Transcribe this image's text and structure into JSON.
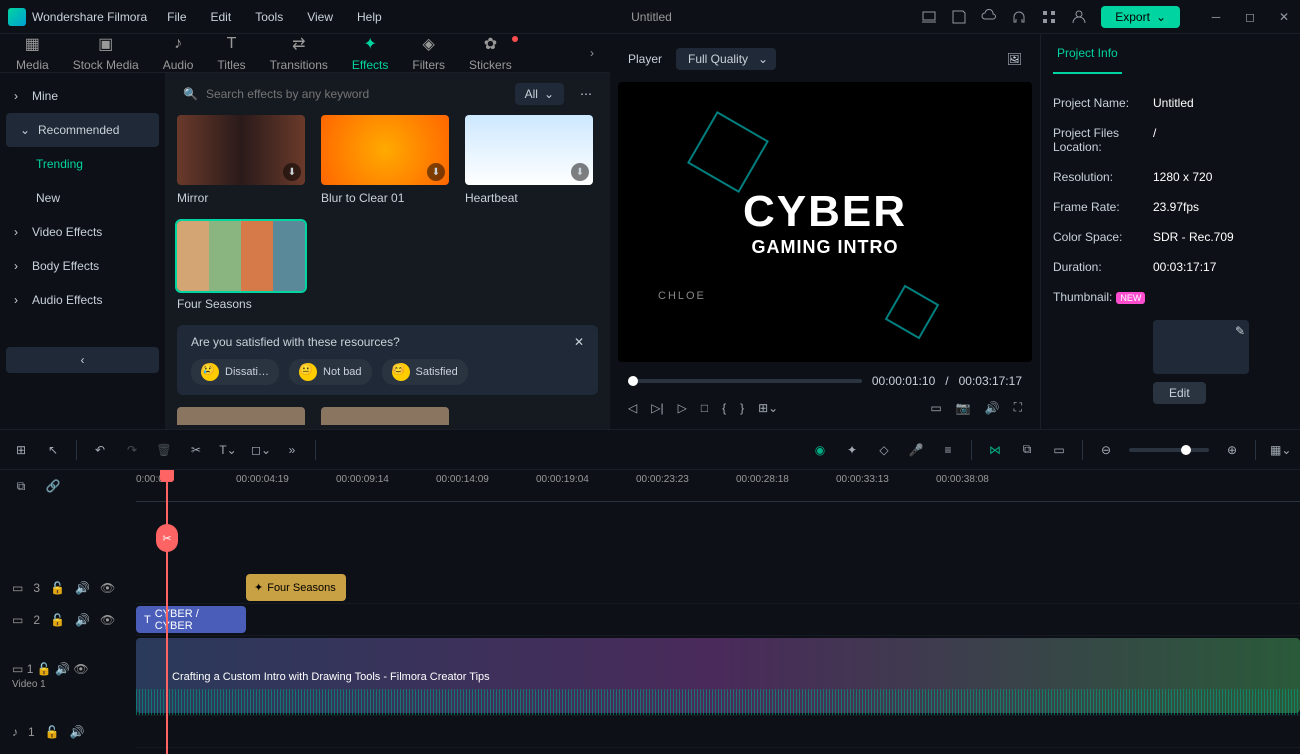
{
  "app": {
    "name": "Wondershare Filmora"
  },
  "menu": [
    "File",
    "Edit",
    "Tools",
    "View",
    "Help"
  ],
  "document": "Untitled",
  "export_label": "Export",
  "tabs": [
    {
      "label": "Media",
      "icon": "▦"
    },
    {
      "label": "Stock Media",
      "icon": "☁"
    },
    {
      "label": "Audio",
      "icon": "♪"
    },
    {
      "label": "Titles",
      "icon": "T"
    },
    {
      "label": "Transitions",
      "icon": "⇄"
    },
    {
      "label": "Effects",
      "icon": "✦",
      "active": true
    },
    {
      "label": "Filters",
      "icon": "◈"
    },
    {
      "label": "Stickers",
      "icon": "✿",
      "new": true
    }
  ],
  "sidebar": {
    "items": [
      "Mine",
      "Recommended",
      "Video Effects",
      "Body Effects",
      "Audio Effects"
    ],
    "subs": [
      "Trending",
      "New"
    ]
  },
  "search": {
    "placeholder": "Search effects by any keyword",
    "filter": "All"
  },
  "effects": [
    {
      "label": "Mirror"
    },
    {
      "label": "Blur to Clear 01"
    },
    {
      "label": "Heartbeat"
    },
    {
      "label": "Four Seasons",
      "selected": true
    }
  ],
  "feedback": {
    "question": "Are you satisfied with these resources?",
    "opts": [
      "Dissati…",
      "Not bad",
      "Satisfied"
    ]
  },
  "player": {
    "label": "Player",
    "quality": "Full Quality",
    "title": "CYBER",
    "subtitle": "GAMING INTRO",
    "tag": "CHLOE",
    "current": "00:00:01:10",
    "total": "00:03:17:17",
    "sep": "/"
  },
  "info": {
    "tab": "Project Info",
    "rows": [
      {
        "k": "Project Name:",
        "v": "Untitled"
      },
      {
        "k": "Project Files Location:",
        "v": "/"
      },
      {
        "k": "Resolution:",
        "v": "1280 x 720"
      },
      {
        "k": "Frame Rate:",
        "v": "23.97fps"
      },
      {
        "k": "Color Space:",
        "v": "SDR - Rec.709"
      },
      {
        "k": "Duration:",
        "v": "00:03:17:17"
      }
    ],
    "thumbnail_label": "Thumbnail:",
    "new_badge": "NEW",
    "edit": "Edit"
  },
  "ruler": [
    "0:00:00",
    "00:00:04:19",
    "00:00:09:14",
    "00:00:14:09",
    "00:00:19:04",
    "00:00:23:23",
    "00:00:28:18",
    "00:00:33:13",
    "00:00:38:08"
  ],
  "tracks": {
    "t3": "3",
    "t2": "2",
    "t1": "1",
    "video1": "Video 1",
    "audio1": "1"
  },
  "clips": {
    "effect": "Four Seasons",
    "title": "CYBER / CYBER",
    "video": "Crafting a Custom Intro with Drawing Tools - Filmora Creator Tips"
  }
}
